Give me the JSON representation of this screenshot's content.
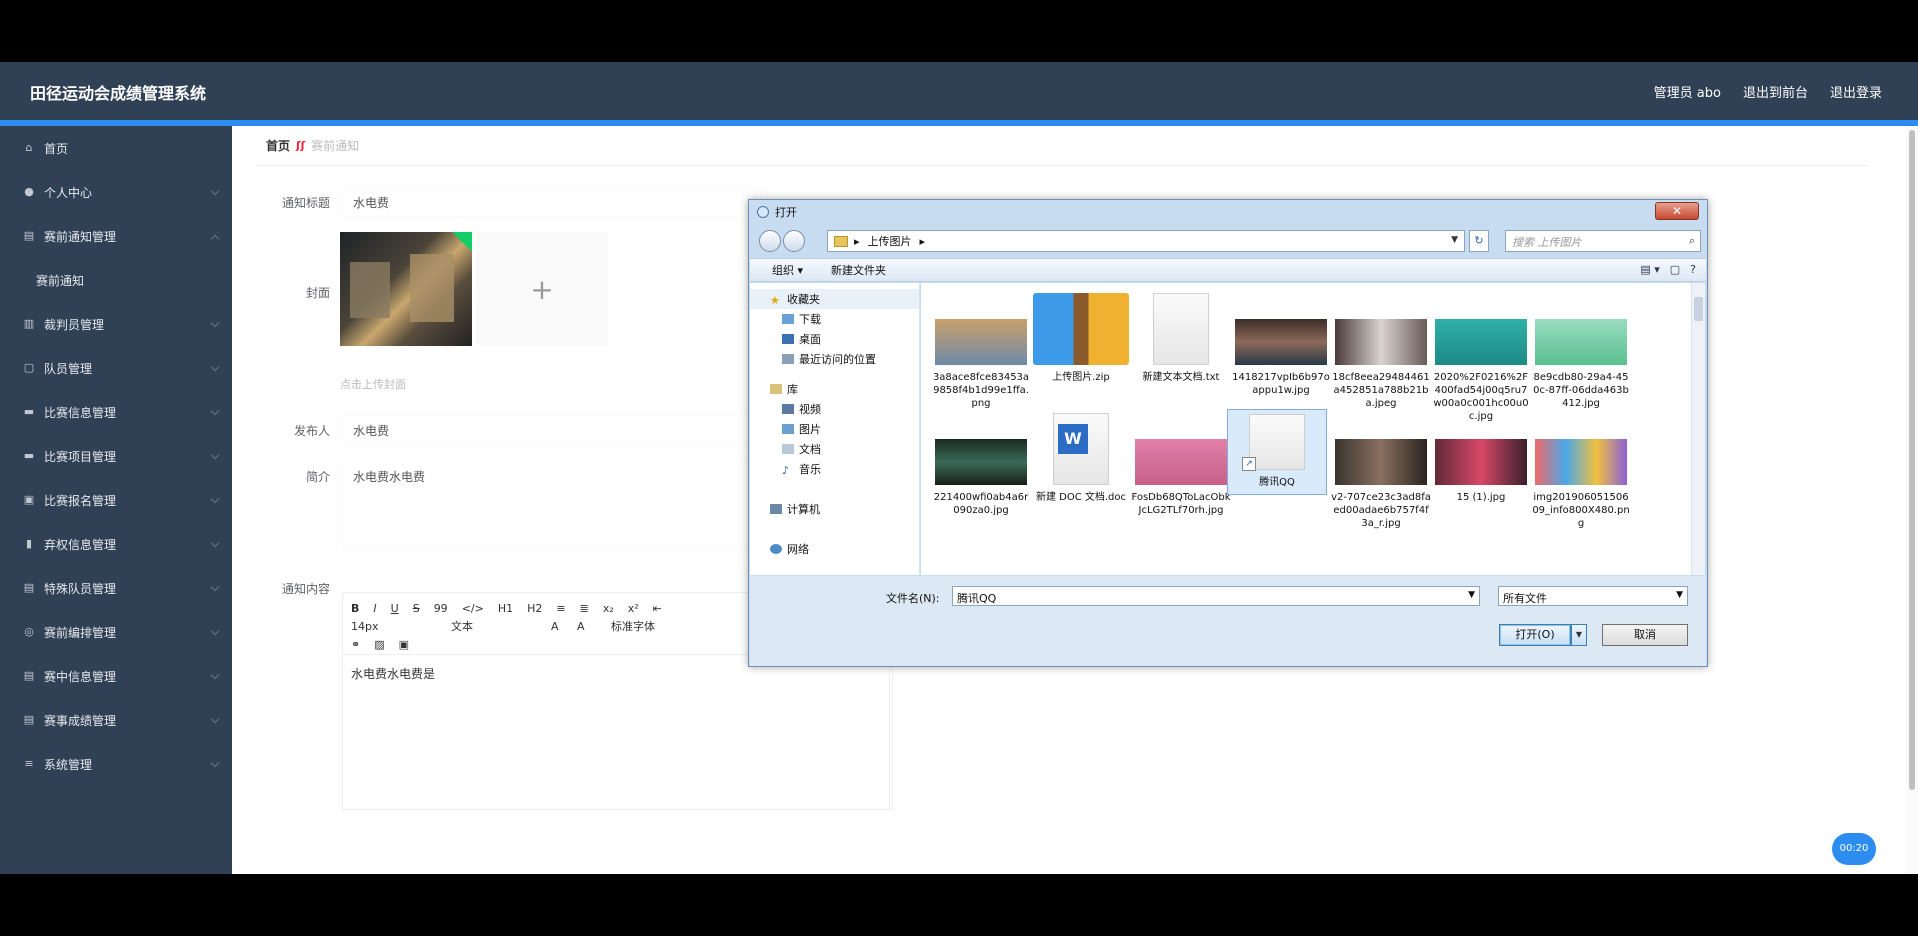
{
  "header": {
    "title": "田径运动会成绩管理系统",
    "admin": "管理员 abo",
    "to_front": "退出到前台",
    "logout": "退出登录"
  },
  "sidebar": {
    "items": [
      {
        "label": "首页",
        "icon": "home-icon"
      },
      {
        "label": "个人中心",
        "icon": "user-icon"
      },
      {
        "label": "赛前通知管理",
        "icon": "notice-icon"
      },
      {
        "label": "赛前通知",
        "icon": ""
      },
      {
        "label": "裁判员管理",
        "icon": "referee-icon"
      },
      {
        "label": "队员管理",
        "icon": "team-icon"
      },
      {
        "label": "比赛信息管理",
        "icon": "info-icon"
      },
      {
        "label": "比赛项目管理",
        "icon": "project-icon"
      },
      {
        "label": "比赛报名管理",
        "icon": "signup-icon"
      },
      {
        "label": "弃权信息管理",
        "icon": "chart-icon"
      },
      {
        "label": "特殊队员管理",
        "icon": "special-icon"
      },
      {
        "label": "赛前编排管理",
        "icon": "schedule-icon"
      },
      {
        "label": "赛中信息管理",
        "icon": "live-icon"
      },
      {
        "label": "赛事成绩管理",
        "icon": "score-icon"
      },
      {
        "label": "系统管理",
        "icon": "menu-icon"
      }
    ]
  },
  "breadcrumb": {
    "home": "首页",
    "current": "赛前通知"
  },
  "form": {
    "title_label": "通知标题",
    "title_value": "水电费",
    "cover_label": "封面",
    "upload_tip": "点击上传封面",
    "publisher_label": "发布人",
    "publisher_value": "水电费",
    "intro_label": "简介",
    "intro_value": "水电费水电费",
    "content_label": "通知内容",
    "content_value": "水电费水电费是"
  },
  "editor": {
    "row1": [
      "B",
      "I",
      "U",
      "S",
      "99",
      "</>",
      "H1",
      "H2",
      "≡",
      "≣",
      "x₂",
      "x²",
      "⇤"
    ],
    "font_size": "14px",
    "text_type": "文本",
    "font_family": "标准字体"
  },
  "timer": "00:20",
  "dialog": {
    "title": "打开",
    "close": "✕",
    "path": "上传图片",
    "search_placeholder": "搜索 上传图片",
    "organize": "组织 ▾",
    "new_folder": "新建文件夹",
    "nav": {
      "favorites": "收藏夹",
      "downloads": "下载",
      "desktop": "桌面",
      "recent": "最近访问的位置",
      "library": "库",
      "video": "视频",
      "pictures": "图片",
      "documents": "文档",
      "music": "音乐",
      "computer": "计算机",
      "network": "网络"
    },
    "files": [
      {
        "name": "3a8ace8fce83453a9858f4b1d99e1ffa.png"
      },
      {
        "name": "上传图片.zip"
      },
      {
        "name": "新建文本文档.txt"
      },
      {
        "name": "1418217vpIb6b97oappu1w.jpg"
      },
      {
        "name": "18cf8eea29484461a452851a788b21ba.jpeg"
      },
      {
        "name": "2020%2F0216%2F400fad54j00q5ru7w00a0c001hc00u0c.jpg"
      },
      {
        "name": "8e9cdb80-29a4-450c-87ff-06dda463b412.jpg"
      },
      {
        "name": "221400wfi0ab4a6r090za0.jpg"
      },
      {
        "name": "新建 DOC 文档.doc"
      },
      {
        "name": "FosDb68QToLacObkJcLG2TLf70rh.jpg"
      },
      {
        "name": "腾讯QQ"
      },
      {
        "name": "v2-707ce23c3ad8faed00adae6b757f4f3a_r.jpg"
      },
      {
        "name": "15 (1).jpg"
      },
      {
        "name": "img20190605150609_info800X480.png"
      }
    ],
    "filename_label": "文件名(N):",
    "filename_value": "腾讯QQ",
    "filetype_value": "所有文件",
    "open_button": "打开(O)",
    "cancel_button": "取消"
  }
}
